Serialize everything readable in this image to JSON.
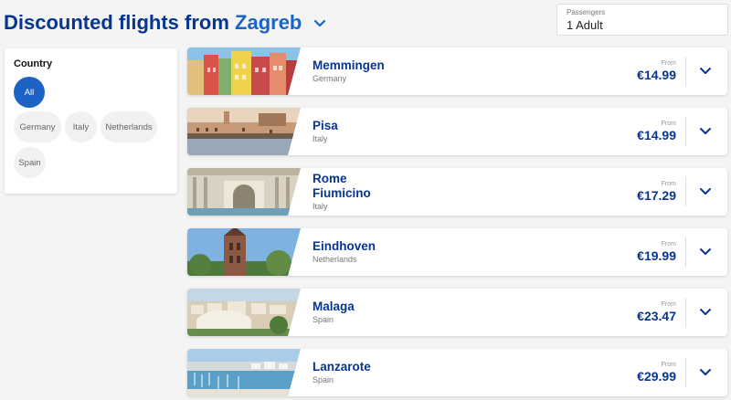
{
  "header": {
    "title_prefix": "Discounted flights from",
    "origin_city": "Zagreb",
    "origin_dropdown_icon": "chevron-down-icon"
  },
  "passengers": {
    "label": "Passengers",
    "value": "1 Adult"
  },
  "filter": {
    "title": "Country",
    "chips": [
      {
        "label": "All",
        "active": true
      },
      {
        "label": "Germany",
        "active": false
      },
      {
        "label": "Italy",
        "active": false
      },
      {
        "label": "Netherlands",
        "active": false
      },
      {
        "label": "Spain",
        "active": false
      }
    ]
  },
  "flights": [
    {
      "name": "Memmingen",
      "country": "Germany",
      "from_label": "From",
      "price": "€14.99",
      "expand_icon": "chevron-down-icon"
    },
    {
      "name": "Pisa",
      "country": "Italy",
      "from_label": "From",
      "price": "€14.99",
      "expand_icon": "chevron-down-icon"
    },
    {
      "name": "Rome Fiumicino",
      "country": "Italy",
      "from_label": "From",
      "price": "€17.29",
      "expand_icon": "chevron-down-icon"
    },
    {
      "name": "Eindhoven",
      "country": "Netherlands",
      "from_label": "From",
      "price": "€19.99",
      "expand_icon": "chevron-down-icon"
    },
    {
      "name": "Malaga",
      "country": "Spain",
      "from_label": "From",
      "price": "€23.47",
      "expand_icon": "chevron-down-icon"
    },
    {
      "name": "Lanzarote",
      "country": "Spain",
      "from_label": "From",
      "price": "€29.99",
      "expand_icon": "chevron-down-icon"
    }
  ],
  "colors": {
    "brand_navy": "#073590",
    "accent_blue": "#1d63c6",
    "background": "#f4f4f4"
  }
}
